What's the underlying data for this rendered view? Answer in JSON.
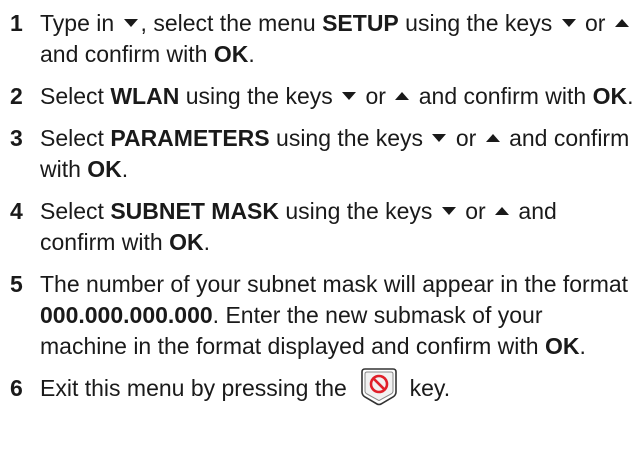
{
  "steps": [
    {
      "num": "1",
      "parts": [
        {
          "t": "text",
          "v": "Type in "
        },
        {
          "t": "icon",
          "v": "down-arrow-icon"
        },
        {
          "t": "text",
          "v": ", select the menu "
        },
        {
          "t": "bold",
          "v": "SETUP"
        },
        {
          "t": "text",
          "v": " using the keys "
        },
        {
          "t": "icon",
          "v": "down-arrow-icon"
        },
        {
          "t": "text",
          "v": " or "
        },
        {
          "t": "icon",
          "v": "up-arrow-icon"
        },
        {
          "t": "text",
          "v": " and confirm with "
        },
        {
          "t": "bold",
          "v": "OK"
        },
        {
          "t": "text",
          "v": "."
        }
      ]
    },
    {
      "num": "2",
      "parts": [
        {
          "t": "text",
          "v": "Select "
        },
        {
          "t": "bold",
          "v": "WLAN"
        },
        {
          "t": "text",
          "v": " using the keys "
        },
        {
          "t": "icon",
          "v": "down-arrow-icon"
        },
        {
          "t": "text",
          "v": " or "
        },
        {
          "t": "icon",
          "v": "up-arrow-icon"
        },
        {
          "t": "text",
          "v": " and confirm with "
        },
        {
          "t": "bold",
          "v": "OK"
        },
        {
          "t": "text",
          "v": "."
        }
      ]
    },
    {
      "num": "3",
      "parts": [
        {
          "t": "text",
          "v": "Select "
        },
        {
          "t": "bold",
          "v": "PARAMETERS"
        },
        {
          "t": "text",
          "v": " using the keys "
        },
        {
          "t": "icon",
          "v": "down-arrow-icon"
        },
        {
          "t": "text",
          "v": " or "
        },
        {
          "t": "icon",
          "v": "up-arrow-icon"
        },
        {
          "t": "text",
          "v": " and confirm with "
        },
        {
          "t": "bold",
          "v": "OK"
        },
        {
          "t": "text",
          "v": "."
        }
      ]
    },
    {
      "num": "4",
      "parts": [
        {
          "t": "text",
          "v": "Select "
        },
        {
          "t": "bold",
          "v": "SUBNET MASK"
        },
        {
          "t": "text",
          "v": " using the keys "
        },
        {
          "t": "icon",
          "v": "down-arrow-icon"
        },
        {
          "t": "text",
          "v": " or "
        },
        {
          "t": "icon",
          "v": "up-arrow-icon"
        },
        {
          "t": "text",
          "v": " and confirm with "
        },
        {
          "t": "bold",
          "v": "OK"
        },
        {
          "t": "text",
          "v": "."
        }
      ]
    },
    {
      "num": "5",
      "parts": [
        {
          "t": "text",
          "v": "The number of your subnet mask will appear in the format "
        },
        {
          "t": "bold",
          "v": "000.000.000.000"
        },
        {
          "t": "text",
          "v": ". Enter the new submask of your machine in the format displayed and confirm with "
        },
        {
          "t": "bold",
          "v": "OK"
        },
        {
          "t": "text",
          "v": "."
        }
      ]
    },
    {
      "num": "6",
      "parts": [
        {
          "t": "text",
          "v": "Exit this menu by pressing the "
        },
        {
          "t": "icon",
          "v": "stop-key-icon"
        },
        {
          "t": "text",
          "v": " key."
        }
      ]
    }
  ],
  "colors": {
    "text": "#1a1a1a",
    "stop_key_red": "#e0202a"
  }
}
